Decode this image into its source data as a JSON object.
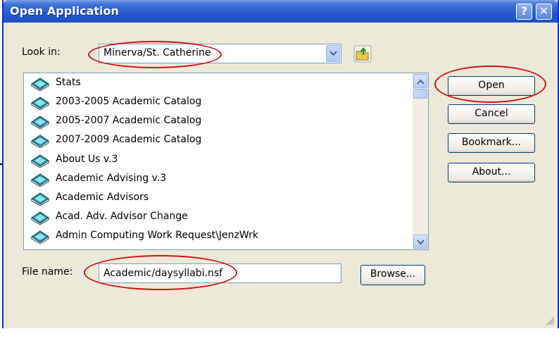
{
  "dialog": {
    "title": "Open Application",
    "help_glyph": "?",
    "close_glyph": "✕"
  },
  "look_in": {
    "label": "Look in:",
    "value": "Minerva/St. Catherine",
    "dropdown_icon": "chevron-down-icon",
    "up_folder_icon": "folder-up-icon"
  },
  "list": {
    "item_icon": "database-book-icon",
    "items": [
      {
        "label": "Stats"
      },
      {
        "label": "2003-2005 Academic Catalog"
      },
      {
        "label": "2005-2007 Academic Catalog"
      },
      {
        "label": "2007-2009 Academic Catalog"
      },
      {
        "label": "About Us v.3"
      },
      {
        "label": "Academic Advising v.3"
      },
      {
        "label": "Academic Advisors"
      },
      {
        "label": "Acad. Adv. Advisor Change"
      },
      {
        "label": "Admin Computing Work Request\\JenzWrk"
      }
    ]
  },
  "buttons": {
    "open": "Open",
    "cancel": "Cancel",
    "bookmark": "Bookmark...",
    "about": "About...",
    "browse": "Browse..."
  },
  "file_name": {
    "label": "File name:",
    "value": "Academic/daysyllabi.nsf"
  },
  "colors": {
    "title_bar": "#2458cf",
    "dialog_bg": "#ece9d8",
    "highlight_oval": "#d2121b"
  }
}
